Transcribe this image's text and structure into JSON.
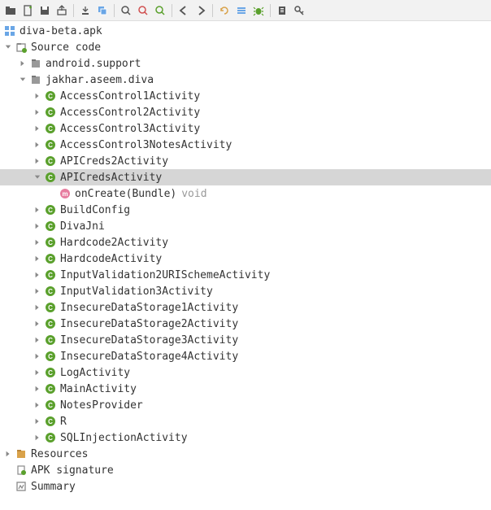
{
  "toolbar_icons": [
    "open-folder-icon",
    "new-file-icon",
    "save-icon",
    "export-icon",
    "sep",
    "step-over-icon",
    "copy-stack-icon",
    "sep",
    "search-icon",
    "search-back-icon",
    "search-forward-icon",
    "sep",
    "arrow-left-icon",
    "arrow-right-icon",
    "sep",
    "sync-icon",
    "flat-icon",
    "bug-icon",
    "sep",
    "log-icon",
    "key-icon"
  ],
  "root": {
    "label": "diva-beta.apk",
    "icon": "apk",
    "children": [
      {
        "label": "Source code",
        "icon": "source",
        "expanded": true,
        "children": [
          {
            "label": "android.support",
            "icon": "package",
            "expanded": false,
            "hasChildren": true
          },
          {
            "label": "jakhar.aseem.diva",
            "icon": "package",
            "expanded": true,
            "children": [
              {
                "label": "AccessControl1Activity",
                "icon": "class",
                "hasChildren": true
              },
              {
                "label": "AccessControl2Activity",
                "icon": "class",
                "hasChildren": true
              },
              {
                "label": "AccessControl3Activity",
                "icon": "class",
                "hasChildren": true
              },
              {
                "label": "AccessControl3NotesActivity",
                "icon": "class",
                "hasChildren": true
              },
              {
                "label": "APICreds2Activity",
                "icon": "class",
                "hasChildren": true
              },
              {
                "label": "APICredsActivity",
                "icon": "class",
                "selected": true,
                "expanded": true,
                "children": [
                  {
                    "label": "onCreate(Bundle)",
                    "icon": "method",
                    "ret": "void"
                  }
                ]
              },
              {
                "label": "BuildConfig",
                "icon": "class",
                "hasChildren": true
              },
              {
                "label": "DivaJni",
                "icon": "class",
                "hasChildren": true
              },
              {
                "label": "Hardcode2Activity",
                "icon": "class",
                "hasChildren": true
              },
              {
                "label": "HardcodeActivity",
                "icon": "class",
                "hasChildren": true
              },
              {
                "label": "InputValidation2URISchemeActivity",
                "icon": "class",
                "hasChildren": true
              },
              {
                "label": "InputValidation3Activity",
                "icon": "class",
                "hasChildren": true
              },
              {
                "label": "InsecureDataStorage1Activity",
                "icon": "class",
                "hasChildren": true
              },
              {
                "label": "InsecureDataStorage2Activity",
                "icon": "class",
                "hasChildren": true
              },
              {
                "label": "InsecureDataStorage3Activity",
                "icon": "class",
                "hasChildren": true
              },
              {
                "label": "InsecureDataStorage4Activity",
                "icon": "class",
                "hasChildren": true
              },
              {
                "label": "LogActivity",
                "icon": "class",
                "hasChildren": true
              },
              {
                "label": "MainActivity",
                "icon": "class",
                "hasChildren": true
              },
              {
                "label": "NotesProvider",
                "icon": "class",
                "hasChildren": true
              },
              {
                "label": "R",
                "icon": "class",
                "hasChildren": true
              },
              {
                "label": "SQLInjectionActivity",
                "icon": "class",
                "hasChildren": true
              }
            ]
          }
        ]
      },
      {
        "label": "Resources",
        "icon": "resources",
        "hasChildren": true
      },
      {
        "label": "APK signature",
        "icon": "signature"
      },
      {
        "label": "Summary",
        "icon": "summary"
      }
    ]
  }
}
